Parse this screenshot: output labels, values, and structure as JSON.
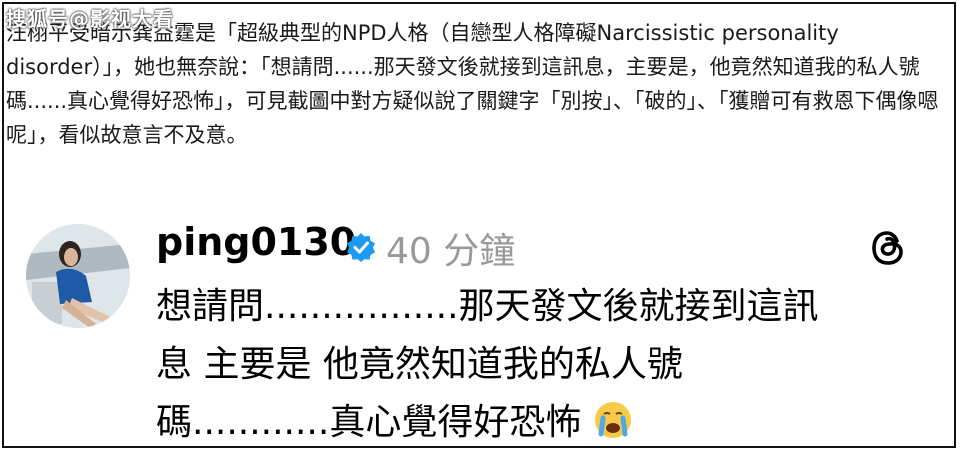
{
  "watermark": "搜狐号@影视大看",
  "article": {
    "text": "汪栩平受暗示龚益霆是「超級典型的NPD人格（自戀型人格障礙Narcissistic personality disorder）」，她也無奈說：「想請問......那天發文後就接到這訊息，主要是，他竟然知道我的私人號碼......真心覺得好恐怖」，可見截圖中對方疑似說了關鍵字「別按」、「破的」、「獲贈可有救恩下偶像嗯呢」，看似故意言不及意。"
  },
  "post": {
    "username": "ping0130",
    "timestamp": "40 分鐘",
    "verified_icon": "verified-badge-icon",
    "platform_icon": "threads-icon",
    "avatar_icon": "avatar",
    "lines": [
      "想請問.................那天發文後就接到這訊",
      "息 主要是 他竟然知道我的私人號",
      "碼............真心覺得好恐怖"
    ],
    "emoji": "crying-face-emoji"
  },
  "colors": {
    "text": "#1a1a1a",
    "timestamp": "#999999",
    "verified": "#1d9bf0",
    "frame": "#111111"
  }
}
